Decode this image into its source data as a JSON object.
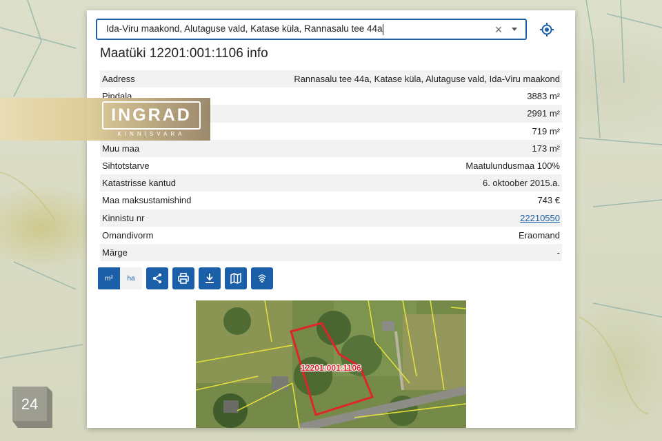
{
  "search": {
    "value": "Ida-Viru maakond, Alutaguse vald, Katase küla, Rannasalu tee 44a",
    "clear_icon": "close-icon",
    "dropdown_icon": "chevron-down-icon"
  },
  "locate_icon": "crosshair-icon",
  "title": "Maatüki 12201:001:1106 info",
  "rows": [
    {
      "label": "Aadress",
      "value": "Rannasalu tee 44a, Katase küla, Alutaguse vald, Ida-Viru maakond"
    },
    {
      "label": "Pindala",
      "value": "3883 m²"
    },
    {
      "label": "",
      "value": "2991 m²"
    },
    {
      "label": "",
      "value": "719 m²"
    },
    {
      "label": "Muu maa",
      "value": "173 m²"
    },
    {
      "label": "Sihtotstarve",
      "value": "Maatulundusmaa 100%"
    },
    {
      "label": "Katastrisse kantud",
      "value": "6. oktoober 2015.a."
    },
    {
      "label": "Maa maksustamishind",
      "value": "743 €"
    },
    {
      "label": "Kinnistu nr",
      "value": "22210550"
    },
    {
      "label": "Omandivorm",
      "value": "Eraomand"
    },
    {
      "label": "Märge",
      "value": "-"
    }
  ],
  "toolbar": {
    "unit_m2": "m²",
    "unit_ha": "ha",
    "buttons": [
      "share-icon",
      "print-icon",
      "download-icon",
      "map-icon",
      "fingerprint-icon"
    ]
  },
  "aerial": {
    "parcel_label": "12201:001:1106"
  },
  "watermark": {
    "brand": "INGRAD",
    "sub": "KINNISVARA",
    "badge": "24"
  },
  "colors": {
    "accent": "#1a5fa8",
    "parcel_outline": "#e0252a",
    "boundary": "#e6e23a"
  }
}
